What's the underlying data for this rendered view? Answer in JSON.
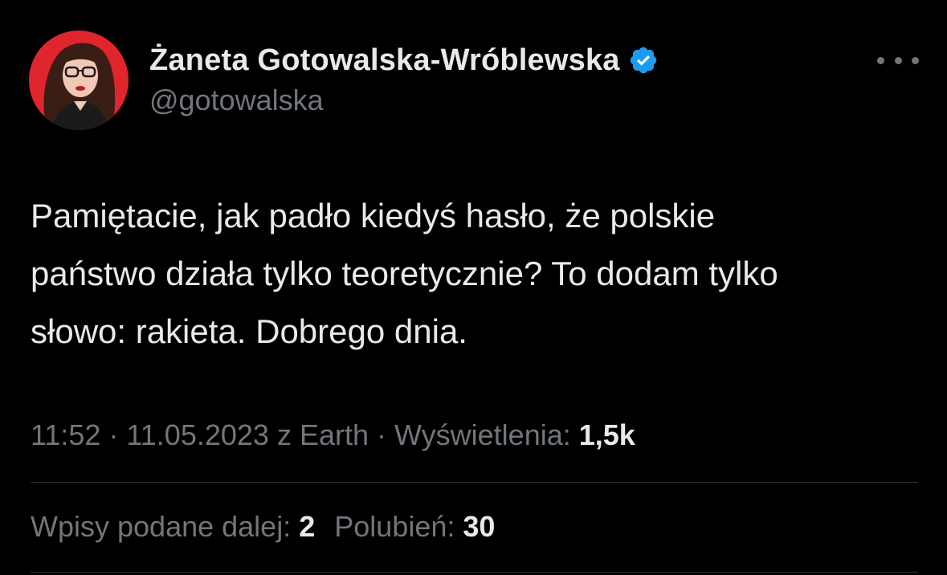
{
  "author": {
    "name": "Żaneta Gotowalska-Wróblewska",
    "handle": "@gotowalska",
    "verified": true,
    "verified_icon": "verified-badge-icon",
    "verified_color": "#1d9bf0",
    "avatar_bg_color": "#e1252d"
  },
  "header": {
    "more_icon": "more-options-icon"
  },
  "tweet": {
    "lines": [
      "Pamiętacie, jak padło kiedyś hasło, że polskie",
      "państwo działa tylko teoretycznie? To dodam tylko",
      "słowo: rakieta. Dobrego dnia."
    ]
  },
  "meta": {
    "time": "11:52",
    "separator": " · ",
    "date": "11.05.2023",
    "source": "z Earth",
    "views_label": "Wyświetlenia:",
    "views_value": "1,5k"
  },
  "stats": {
    "retweets_label": "Wpisy podane dalej:",
    "retweets_value": "2",
    "likes_label": "Polubień:",
    "likes_value": "30"
  },
  "colors": {
    "background": "#000000",
    "primary_text": "#e7e9ea",
    "secondary_text": "#71767b",
    "divider": "#2f3336"
  }
}
